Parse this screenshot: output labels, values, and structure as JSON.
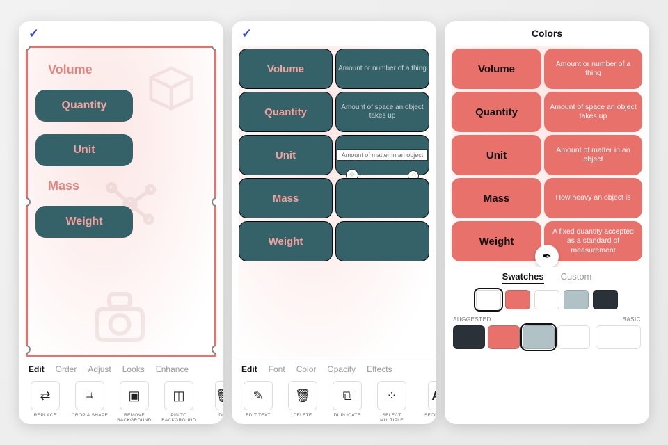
{
  "colors": {
    "teal": "#356168",
    "coral": "#e8716c",
    "coral_text": "#f2a29c",
    "charcoal": "#2b3138",
    "lightblue": "#b1c2c7",
    "white": "#ffffff"
  },
  "panel1": {
    "tabs": [
      "Edit",
      "Order",
      "Adjust",
      "Looks",
      "Enhance"
    ],
    "active_tab": "Edit",
    "tools": [
      {
        "name": "replace",
        "icon": "⇄",
        "label": "REPLACE"
      },
      {
        "name": "crop",
        "icon": "⌗",
        "label": "CROP & SHAPE"
      },
      {
        "name": "removebg",
        "icon": "▧",
        "label": "REMOVE BACKGROUND"
      },
      {
        "name": "pinbg",
        "icon": "⬚",
        "label": "PIN TO BACKGROUND"
      },
      {
        "name": "delete",
        "icon": "🗑",
        "label": "DEL"
      }
    ],
    "items": [
      {
        "type": "ghost",
        "label": "Volume"
      },
      {
        "type": "pill",
        "label": "Quantity"
      },
      {
        "type": "pill",
        "label": "Unit"
      },
      {
        "type": "ghost",
        "label": "Mass"
      },
      {
        "type": "pill",
        "label": "Weight"
      }
    ]
  },
  "panel2": {
    "tabs": [
      "Edit",
      "Font",
      "Color",
      "Opacity",
      "Effects"
    ],
    "active_tab": "Edit",
    "tools": [
      {
        "name": "edittext",
        "icon": "✎",
        "label": "EDIT TEXT"
      },
      {
        "name": "delete",
        "icon": "🗑",
        "label": "DELETE"
      },
      {
        "name": "duplicate",
        "icon": "⧉",
        "label": "DUPLICATE"
      },
      {
        "name": "selectmulti",
        "icon": "⁘",
        "label": "SELECT MULTIPLE"
      },
      {
        "name": "secondary",
        "icon": "A",
        "label": "SECONDA"
      }
    ],
    "rows": [
      {
        "term": "Volume",
        "def": "Amount or number of a thing"
      },
      {
        "term": "Quantity",
        "def": "Amount of space an object takes up"
      },
      {
        "term": "Unit",
        "def": "Amount of matter in an object",
        "selected": true
      },
      {
        "term": "Mass",
        "def": ""
      },
      {
        "term": "Weight",
        "def": ""
      }
    ]
  },
  "panel3": {
    "title": "Colors",
    "swatch_tabs": [
      "Swatches",
      "Custom"
    ],
    "active_swatch_tab": "Swatches",
    "rows": [
      {
        "term": "Volume",
        "def": "Amount or number of a thing"
      },
      {
        "term": "Quantity",
        "def": "Amount of space an object takes up"
      },
      {
        "term": "Unit",
        "def": "Amount of matter in an object"
      },
      {
        "term": "Mass",
        "def": "How heavy an object is"
      },
      {
        "term": "Weight",
        "def": "A fixed quantity accepted as a standard of measurement"
      }
    ],
    "swatches_top": [
      {
        "color": "#ffffff",
        "selected": true
      },
      {
        "color": "#e8716c"
      },
      {
        "color": "#ffffff"
      },
      {
        "color": "#b1c2c7"
      },
      {
        "color": "#2b3138"
      }
    ],
    "groups": {
      "suggested_label": "SUGGESTED",
      "basic_label": "BASIC",
      "suggested": [
        {
          "color": "#2b3138"
        },
        {
          "color": "#e8716c"
        },
        {
          "color": "#b1c2c7",
          "selected": true
        },
        {
          "color": "#ffffff"
        }
      ],
      "basic": [
        {
          "color": "#ffffff"
        }
      ]
    }
  }
}
